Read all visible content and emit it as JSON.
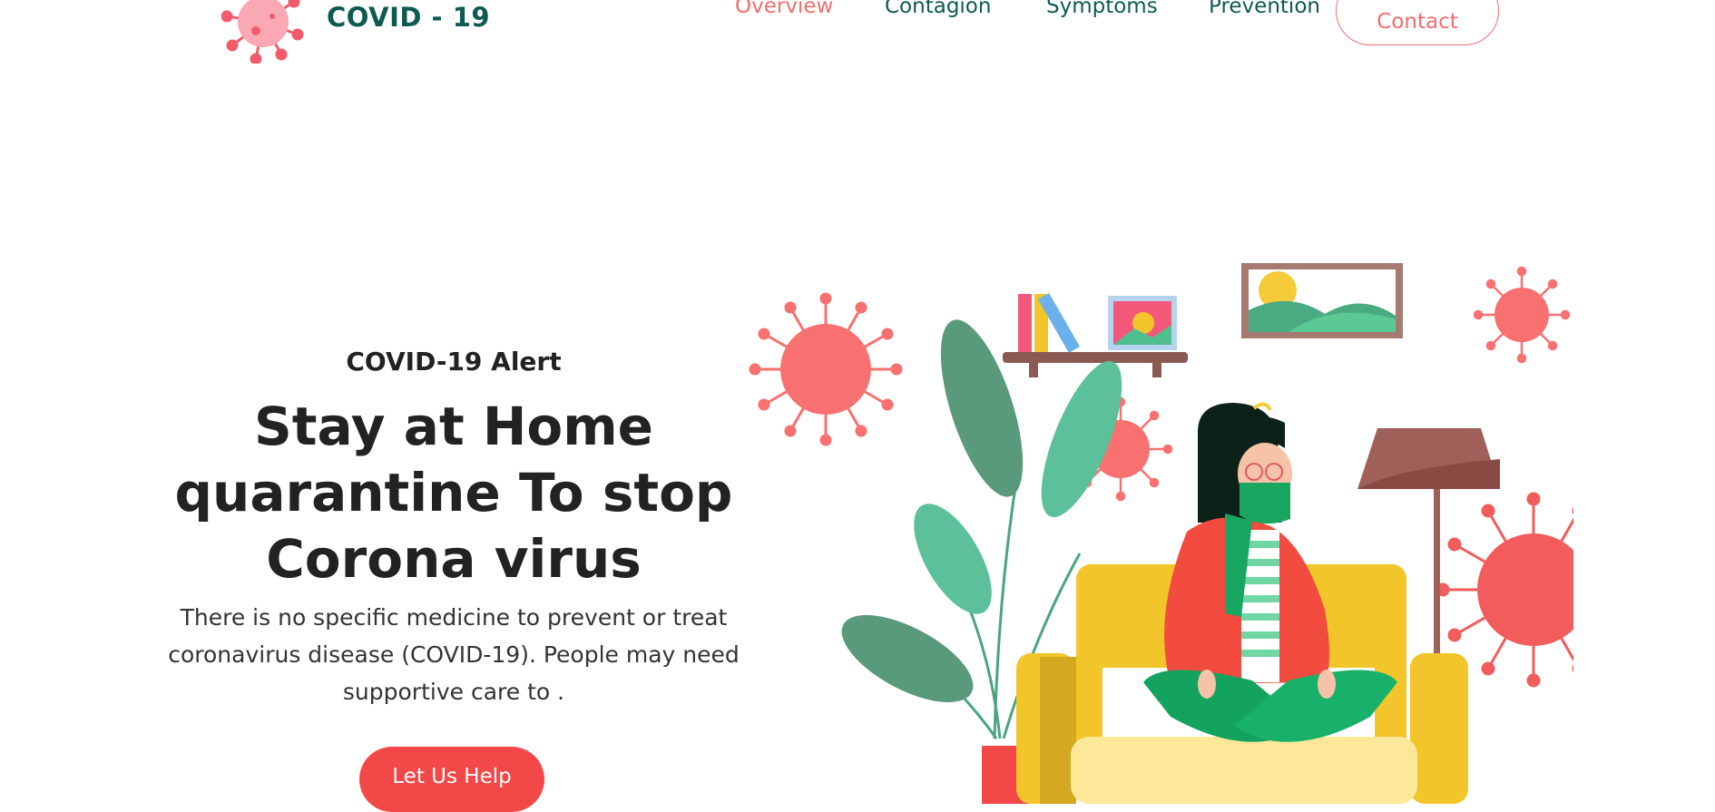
{
  "header": {
    "brand": "COVID - 19",
    "nav": [
      {
        "label": "Overview",
        "active": true
      },
      {
        "label": "Contagion",
        "active": false
      },
      {
        "label": "Symptoms",
        "active": false
      },
      {
        "label": "Prevention",
        "active": false
      }
    ],
    "contact_label": "Contact"
  },
  "hero": {
    "alert": "COVID-19 Alert",
    "headline_lines": [
      "Stay at Home",
      "quarantine To stop",
      "Corona virus"
    ],
    "description_lines": [
      "There is no specific medicine to prevent or treat",
      "coronavirus disease (COVID-19). People may need",
      "supportive care to ."
    ],
    "cta_label": "Let Us Help"
  },
  "colors": {
    "brand": "#0e5a52",
    "accent": "#f26d6d",
    "cta": "#f24848",
    "virus": "#f87070",
    "leaf": "#4fc08d",
    "sofa": "#f2c62a",
    "sweater": "#f24b3f",
    "pants": "#14a25f"
  },
  "illustration": {
    "subject": "woman-sitting-on-sofa-with-mask-icon"
  }
}
